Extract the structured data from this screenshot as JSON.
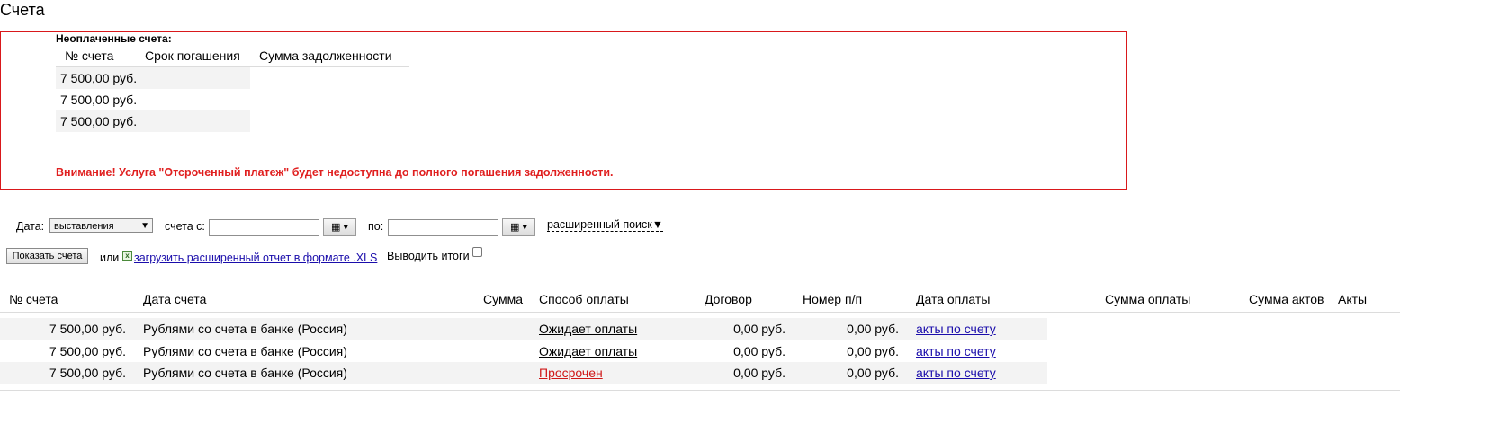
{
  "page": {
    "title": "Счета"
  },
  "unpaid": {
    "title": "Неоплаченные счета:",
    "headers": [
      "№ счета",
      "Срок погашения",
      "Сумма задолженности"
    ],
    "rows": [
      {
        "amount": "7 500,00 руб."
      },
      {
        "amount": "7 500,00 руб."
      },
      {
        "amount": "7 500,00 руб."
      }
    ],
    "warning": "Внимание! Услуга \"Отсроченный платеж\" будет недоступна до полного погашения задолженности."
  },
  "filters": {
    "date_label": "Дата:",
    "date_type_selected": "выставления",
    "from_label": "счета с:",
    "from_value": "",
    "to_label": "по:",
    "to_value": "",
    "calendar_icon": "calendar-icon",
    "advanced_search": "расширенный поиск▼",
    "show_button": "Показать счета",
    "or_text": "или",
    "xls_icon": "excel-icon",
    "xls_link": "загрузить расширенный отчет в формате .XLS",
    "totals_label": "Выводить итоги",
    "totals_checked": false
  },
  "invoices": {
    "headers": {
      "number": "№ счета",
      "date": "Дата счета",
      "sum": "Сумма",
      "method": "Способ оплаты",
      "contract": "Договор",
      "order_no": "Номер п/п",
      "pay_date": "Дата оплаты",
      "pay_sum": "Сумма оплаты",
      "acts_sum": "Сумма актов",
      "acts": "Акты"
    },
    "rows": [
      {
        "number": "7 500,00 руб.",
        "date": "Рублями со счета в банке (Россия)",
        "status": "Ожидает оплаты",
        "v1": "0,00 руб.",
        "v2": "0,00 руб.",
        "acts": "акты по счету"
      },
      {
        "number": "7 500,00 руб.",
        "date": "Рублями со счета в банке (Россия)",
        "status": "Ожидает оплаты",
        "v1": "0,00 руб.",
        "v2": "0,00 руб.",
        "acts": "акты по счету"
      },
      {
        "number": "7 500,00 руб.",
        "date": "Рублями со счета в банке (Россия)",
        "status": "Просрочен",
        "v1": "0,00 руб.",
        "v2": "0,00 руб.",
        "acts": "акты по счету"
      }
    ]
  },
  "colors": {
    "accent_red": "#d9181b",
    "link_blue": "#1a0dab",
    "row_shade": "#f3f3f3"
  }
}
